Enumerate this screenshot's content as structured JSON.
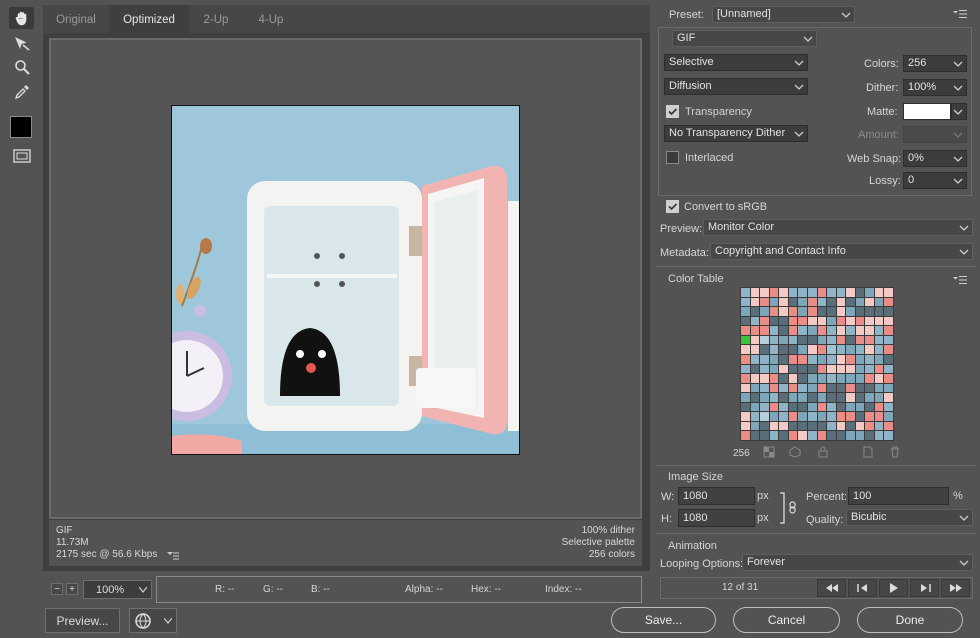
{
  "tabs": [
    {
      "label": "Original"
    },
    {
      "label": "Optimized"
    },
    {
      "label": "2-Up"
    },
    {
      "label": "4-Up"
    }
  ],
  "info_left": {
    "format": "GIF",
    "size": "11.73M",
    "time": "2175 sec @ 56.6 Kbps"
  },
  "info_right": {
    "dither": "100% dither",
    "palette": "Selective palette",
    "colors": "256 colors"
  },
  "statusbar": {
    "zoom": "100%",
    "r": "R: --",
    "g": "G: --",
    "b": "B: --",
    "alpha": "Alpha: --",
    "hex": "Hex: --",
    "index": "Index: --"
  },
  "buttons": {
    "preview": "Preview...",
    "save": "Save...",
    "cancel": "Cancel",
    "done": "Done"
  },
  "settings": {
    "preset_label": "Preset:",
    "preset_value": "[Unnamed]",
    "format": "GIF",
    "reduction": "Selective",
    "dither_algo": "Diffusion",
    "colors_label": "Colors:",
    "colors_value": "256",
    "dither_label": "Dither:",
    "dither_value": "100%",
    "transparency_label": "Transparency",
    "matte_label": "Matte:",
    "transparency_dither": "No Transparency Dither",
    "amount_label": "Amount:",
    "interlaced_label": "Interlaced",
    "websnap_label": "Web Snap:",
    "websnap_value": "0%",
    "lossy_label": "Lossy:",
    "lossy_value": "0",
    "convert_srgb": "Convert to sRGB",
    "preview_label": "Preview:",
    "preview_value": "Monitor Color",
    "metadata_label": "Metadata:",
    "metadata_value": "Copyright and Contact Info"
  },
  "color_table": {
    "title": "Color Table",
    "count": "256"
  },
  "image_size": {
    "title": "Image Size",
    "w_label": "W:",
    "w_value": "1080",
    "h_label": "H:",
    "h_value": "1080",
    "unit": "px",
    "percent_label": "Percent:",
    "percent_value": "100",
    "percent_unit": "%",
    "quality_label": "Quality:",
    "quality_value": "Bicubic"
  },
  "animation": {
    "title": "Animation",
    "looping_label": "Looping Options:",
    "looping_value": "Forever",
    "frame": "12 of 31"
  },
  "colors": {
    "accent_bg": "#535353",
    "panel_dark": "#3c3c3c",
    "photo_bg": "#9ec7db"
  }
}
